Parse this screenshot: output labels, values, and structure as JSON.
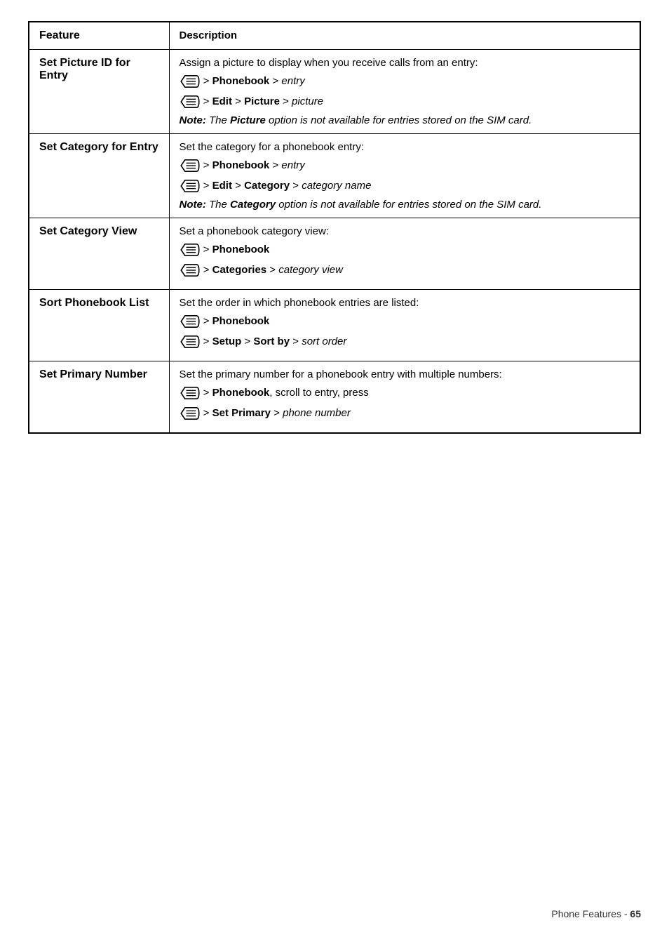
{
  "header": {
    "feature_label": "Feature",
    "description_label": "Description"
  },
  "rows": [
    {
      "feature": "Set Picture ID for Entry",
      "description_main": "Assign a picture to display when you receive calls from an entry:",
      "nav_lines": [
        {
          "parts": [
            {
              "type": "icon"
            },
            {
              "type": "text",
              "text": " > "
            },
            {
              "type": "bold",
              "text": "Phonebook"
            },
            {
              "type": "text",
              "text": " > "
            },
            {
              "type": "italic",
              "text": "entry"
            }
          ]
        },
        {
          "parts": [
            {
              "type": "icon"
            },
            {
              "type": "text",
              "text": " > "
            },
            {
              "type": "bold",
              "text": "Edit"
            },
            {
              "type": "text",
              "text": " > "
            },
            {
              "type": "bold",
              "text": "Picture"
            },
            {
              "type": "text",
              "text": " > "
            },
            {
              "type": "italic",
              "text": "picture"
            }
          ]
        }
      ],
      "note": {
        "label": "Note:",
        "text": " The ",
        "bold_word": "Picture",
        "rest": " option is not available for entries stored on the SIM card."
      }
    },
    {
      "feature": "Set Category for Entry",
      "description_main": "Set the category for a phonebook entry:",
      "nav_lines": [
        {
          "parts": [
            {
              "type": "icon"
            },
            {
              "type": "text",
              "text": " > "
            },
            {
              "type": "bold",
              "text": "Phonebook"
            },
            {
              "type": "text",
              "text": " > "
            },
            {
              "type": "italic",
              "text": "entry"
            }
          ]
        },
        {
          "parts": [
            {
              "type": "icon"
            },
            {
              "type": "text",
              "text": " > "
            },
            {
              "type": "bold",
              "text": "Edit"
            },
            {
              "type": "text",
              "text": " > "
            },
            {
              "type": "bold",
              "text": "Category"
            },
            {
              "type": "text",
              "text": " > "
            },
            {
              "type": "italic",
              "text": "category name"
            }
          ]
        }
      ],
      "note": {
        "label": "Note:",
        "text": " The ",
        "bold_word": "Category",
        "rest": " option is not available for entries stored on the SIM card."
      }
    },
    {
      "feature": "Set Category View",
      "description_main": "Set a phonebook category view:",
      "nav_lines": [
        {
          "parts": [
            {
              "type": "icon"
            },
            {
              "type": "text",
              "text": " > "
            },
            {
              "type": "bold",
              "text": "Phonebook"
            }
          ]
        },
        {
          "parts": [
            {
              "type": "icon"
            },
            {
              "type": "text",
              "text": " > "
            },
            {
              "type": "bold",
              "text": "Categories"
            },
            {
              "type": "text",
              "text": " > "
            },
            {
              "type": "italic",
              "text": "category view"
            }
          ]
        }
      ],
      "note": null
    },
    {
      "feature": "Sort Phonebook List",
      "description_main": "Set the order in which phonebook entries are listed:",
      "nav_lines": [
        {
          "parts": [
            {
              "type": "icon"
            },
            {
              "type": "text",
              "text": " > "
            },
            {
              "type": "bold",
              "text": "Phonebook"
            }
          ]
        },
        {
          "parts": [
            {
              "type": "icon"
            },
            {
              "type": "text",
              "text": " > "
            },
            {
              "type": "bold",
              "text": "Setup"
            },
            {
              "type": "text",
              "text": " > "
            },
            {
              "type": "bold",
              "text": "Sort by"
            },
            {
              "type": "text",
              "text": " > "
            },
            {
              "type": "italic",
              "text": "sort order"
            }
          ]
        }
      ],
      "note": null
    },
    {
      "feature": "Set Primary Number",
      "description_main": "Set the primary number for a phonebook entry with multiple numbers:",
      "nav_lines": [
        {
          "parts": [
            {
              "type": "icon"
            },
            {
              "type": "text",
              "text": " > "
            },
            {
              "type": "bold",
              "text": "Phonebook"
            },
            {
              "type": "text",
              "text": ", scroll to entry, press"
            }
          ]
        },
        {
          "parts": [
            {
              "type": "icon"
            },
            {
              "type": "text",
              "text": " > "
            },
            {
              "type": "bold",
              "text": "Set Primary"
            },
            {
              "type": "text",
              "text": " > "
            },
            {
              "type": "italic",
              "text": "phone number"
            }
          ]
        }
      ],
      "note": null
    }
  ],
  "footer": {
    "text": "Phone Features - ",
    "page_number": "65"
  }
}
